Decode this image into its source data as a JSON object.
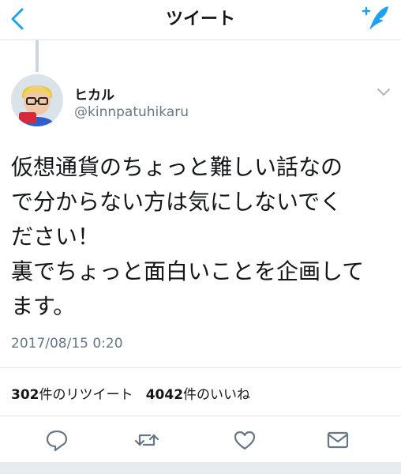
{
  "header": {
    "title": "ツイート",
    "back_icon": "chevron-left-icon",
    "compose_icon": "compose-tweet-icon",
    "accent_color": "#1da1f2"
  },
  "tweet": {
    "author": {
      "name": "ヒカル",
      "handle": "@kinnpatuhikaru"
    },
    "text_lines": [
      "仮想通貨のちょっと難しい話なの",
      "で分からない方は気にしないでく",
      "ださい！",
      "裏でちょっと面白いことを企画して",
      "ます。"
    ],
    "timestamp": "2017/08/15 0:20",
    "stats": {
      "retweets": {
        "count": "302",
        "label": "件のリツイート"
      },
      "likes": {
        "count": "4042",
        "label": "件のいいね"
      }
    }
  },
  "actions": [
    {
      "name": "reply",
      "icon": "reply-icon"
    },
    {
      "name": "retweet",
      "icon": "retweet-icon"
    },
    {
      "name": "like",
      "icon": "heart-icon"
    },
    {
      "name": "share",
      "icon": "mail-icon"
    }
  ]
}
